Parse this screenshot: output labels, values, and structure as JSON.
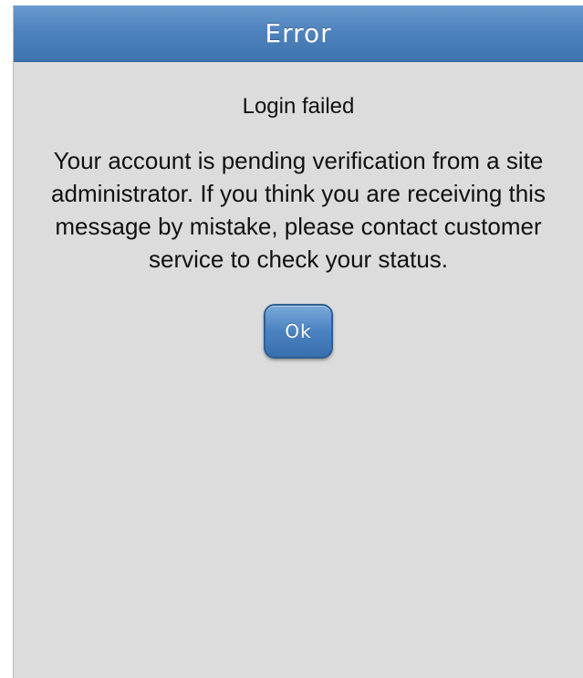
{
  "dialog": {
    "title": "Error",
    "subtitle": "Login failed",
    "message": "Your account is pending verification from a site administrator. If you think you are receiving this message by mistake, please contact customer service to check your status.",
    "ok_label": "Ok"
  },
  "colors": {
    "titlebar": "#4f83bd",
    "background": "#dcdcdc",
    "button": "#4b82c0",
    "text": "#111111"
  }
}
